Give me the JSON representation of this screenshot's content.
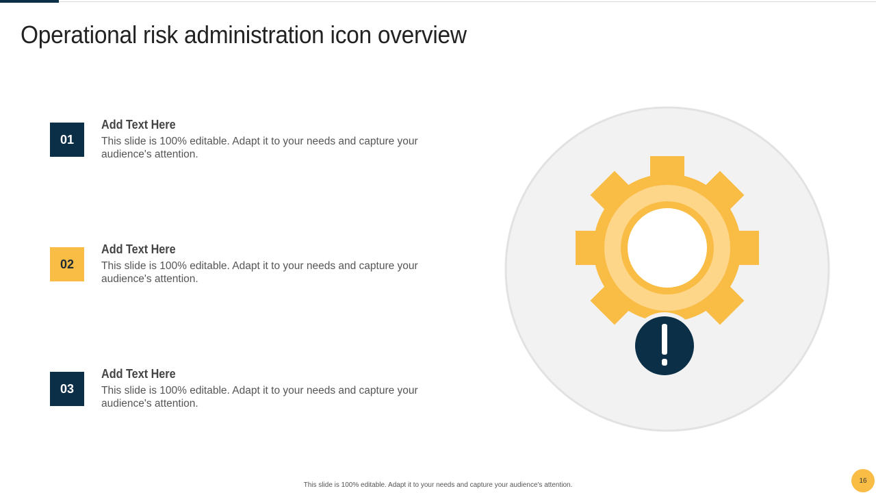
{
  "title": "Operational risk administration icon overview",
  "items": [
    {
      "number": "01",
      "heading": "Add Text Here",
      "text": "This slide is 100% editable. Adapt it to your needs and capture your audience's attention."
    },
    {
      "number": "02",
      "heading": "Add Text Here",
      "text": "This slide is 100% editable. Adapt it to your needs and capture your audience's attention."
    },
    {
      "number": "03",
      "heading": "Add Text Here",
      "text": "This slide is 100% editable. Adapt it to your needs and capture your audience's attention."
    }
  ],
  "footer": "This slide is 100% editable.  Adapt it to your needs and capture your audience's attention.",
  "page_number": "16",
  "colors": {
    "navy": "#0b2f47",
    "yellow": "#f9bc45",
    "light_yellow": "#fdd68a",
    "circle_bg": "#f2f2f2"
  }
}
